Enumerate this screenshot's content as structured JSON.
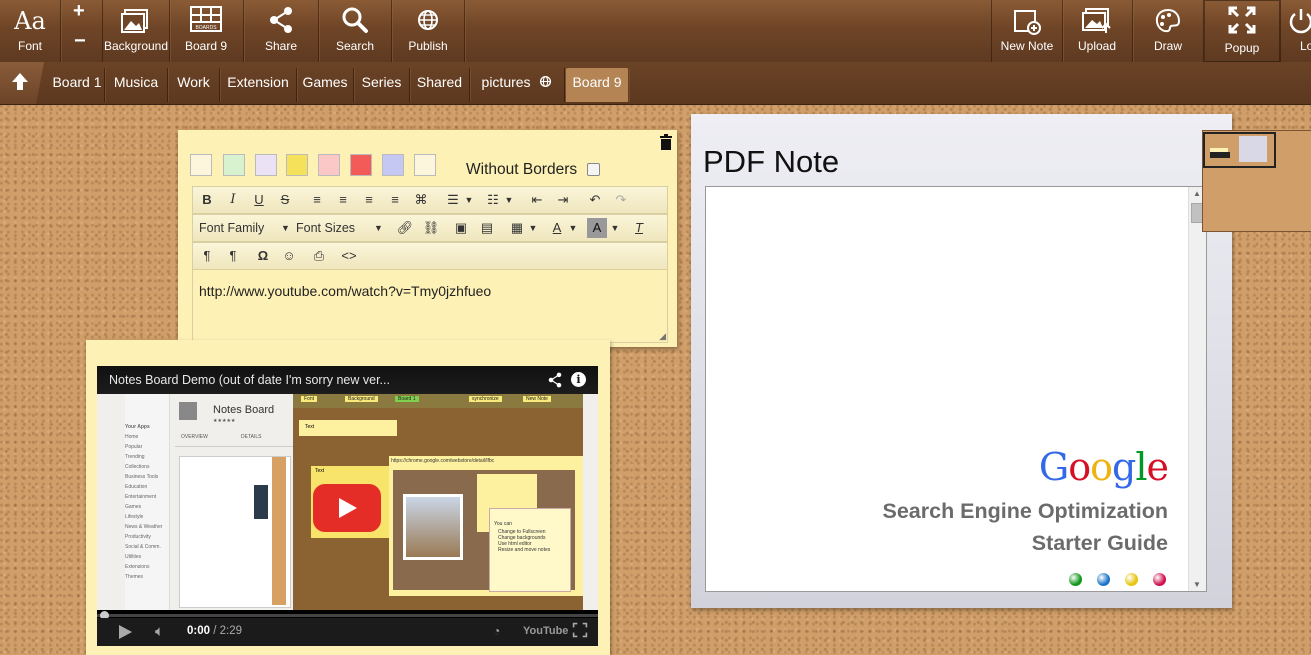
{
  "toolbar": {
    "font_label": "Font",
    "font_glyph": "Aa",
    "plus_glyph": "+",
    "minus_glyph": "−",
    "background_label": "Background",
    "board_label": "Board 9",
    "board_icon_text": "BOARDS",
    "share_label": "Share",
    "search_label": "Search",
    "publish_label": "Publish",
    "new_note_label": "New Note",
    "upload_label": "Upload",
    "draw_label": "Draw",
    "popup_label": "Popup",
    "logout_label": "Lo"
  },
  "tabs": [
    {
      "label": "Board 1"
    },
    {
      "label": "Musica"
    },
    {
      "label": "Work"
    },
    {
      "label": "Extension"
    },
    {
      "label": "Games"
    },
    {
      "label": "Series"
    },
    {
      "label": "Shared"
    },
    {
      "label": "pictures"
    },
    {
      "label": "Board 9"
    }
  ],
  "editor": {
    "without_borders_label": "Without Borders",
    "font_family_label": "Font Family",
    "font_sizes_label": "Font Sizes",
    "content": "http://www.youtube.com/watch?v=Tmy0jzhfueo",
    "swatch_colors": [
      "#fdf6dc",
      "#d8f1cf",
      "#ece2f5",
      "#f6e15b",
      "#fbc7c7",
      "#f35b58",
      "#c5c8f3",
      "#fcf6dc"
    ]
  },
  "video": {
    "title": "Notes Board Demo (out of date I'm sorry new ver...",
    "time_current": "0:00",
    "time_sep": " / ",
    "time_total": "2:29",
    "youtube_label": "YouTube",
    "thumb": {
      "app_title": "Notes Board",
      "tab_overview": "OVERVIEW",
      "tab_details": "DETAILS",
      "nav_your_apps": "Your Apps",
      "nav_items": [
        "Home",
        "Popular",
        "Trending",
        "Collections",
        "Business Tools",
        "Education",
        "Entertainment",
        "Games",
        "Lifestyle",
        "News & Weather",
        "Productivity",
        "Social & Comm.",
        "Utilities",
        "Extensions",
        "Themes"
      ],
      "btn_font": "Font",
      "btn_background": "Background",
      "btn_board": "Board 1",
      "btn_sync": "synchronize",
      "btn_new_note": "New Note",
      "note_text": "Text",
      "note2_text": "Text",
      "url_text": "https://chrome.google.com/webstore/detail/lfbc",
      "list_title": "You can",
      "list_items": [
        "Change to Fullscreen",
        "Change backgrounds",
        "Use html editor",
        "Resize and move notes"
      ]
    }
  },
  "pdf": {
    "title": "PDF Note",
    "google_letters": [
      {
        "ch": "G",
        "color": "#3369e8"
      },
      {
        "ch": "o",
        "color": "#d50f25"
      },
      {
        "ch": "o",
        "color": "#eeb211"
      },
      {
        "ch": "g",
        "color": "#3369e8"
      },
      {
        "ch": "l",
        "color": "#009925"
      },
      {
        "ch": "e",
        "color": "#d50f25"
      }
    ],
    "line1": "Search Engine Optimization",
    "line2": "Starter Guide",
    "dots": [
      "#109618",
      "#1a73c8",
      "#e8c40f",
      "#d0104c"
    ]
  },
  "colors": {
    "wood_dark": "#5e3a21",
    "note_yellow": "#fdf1b5",
    "active_tab": "#b48454"
  }
}
